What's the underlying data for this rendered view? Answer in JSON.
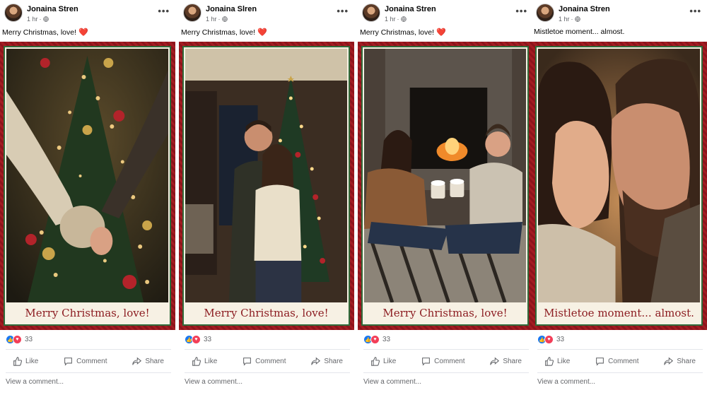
{
  "posts": [
    {
      "author": "Jonaina Stren",
      "time": "1 hr",
      "caption": "Merry Christmas, love!",
      "caption_emoji": "❤️",
      "card_text": "Merry Christmas, love!",
      "reaction_count": "33",
      "actions": {
        "like": "Like",
        "comment": "Comment",
        "share": "Share"
      },
      "view_comment": "View a comment..."
    },
    {
      "author": "Jonaina Slren",
      "time": "1 hr",
      "caption": "Merry Christmas, love!",
      "caption_emoji": "❤️",
      "card_text": "Merry Christmas, love!",
      "reaction_count": "33",
      "actions": {
        "like": "Like",
        "comment": "Comment",
        "share": "Share"
      },
      "view_comment": "View a comment..."
    },
    {
      "author": "Jonaina Stren",
      "time": "1 hr",
      "caption": "Merry Christmas, love!",
      "caption_emoji": "❤️",
      "card_text": "Merry Christmas, love!",
      "reaction_count": "33",
      "actions": {
        "like": "Like",
        "comment": "Comment",
        "share": "Share"
      },
      "view_comment": "View a comment..."
    },
    {
      "author": "Jonaina Stren",
      "time": "1 hr",
      "caption": "Mistletoe moment... almost.",
      "caption_emoji": "",
      "card_text": "Mistletoe moment... almost.",
      "reaction_count": "33",
      "actions": {
        "like": "Like",
        "comment": "Comment",
        "share": "Share"
      },
      "view_comment": "View a comment..."
    }
  ],
  "icons": {
    "more": "more-options-icon",
    "globe": "globe-icon",
    "like": "thumbs-up-icon",
    "comment": "comment-bubble-icon",
    "share": "share-arrow-icon"
  },
  "colors": {
    "card_red": "#a31c22",
    "card_border_green": "#2f6b3a",
    "card_text": "#8b1a1f",
    "like_blue": "#1877f2",
    "love_red": "#f33e58"
  }
}
